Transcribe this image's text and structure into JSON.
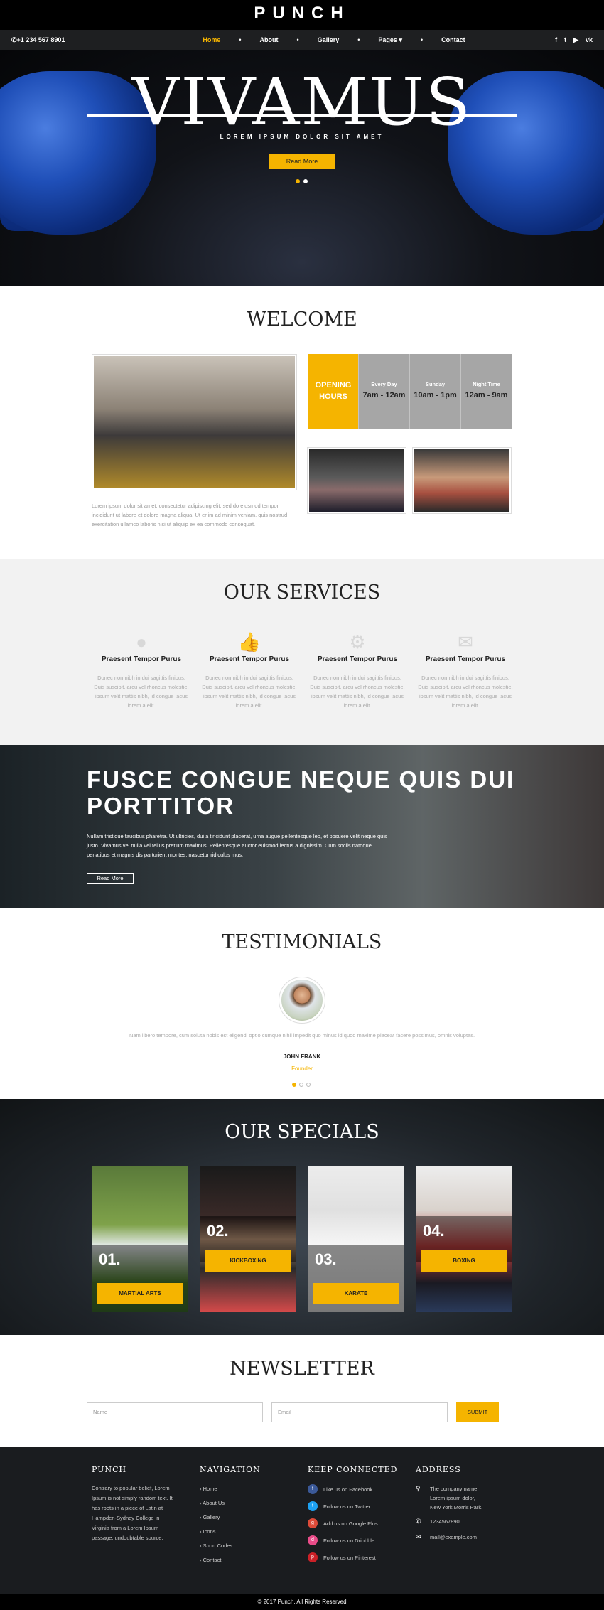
{
  "brand": "PUNCH",
  "nav": {
    "phone": "+1 234 567 8901",
    "items": [
      "Home",
      "About",
      "Gallery",
      "Pages",
      "Contact"
    ],
    "separator": "•",
    "social": [
      "f",
      "🐦",
      "▶",
      "vk"
    ],
    "active_color": "#f5b400"
  },
  "hero": {
    "title": "VIVAMUS",
    "subtitle": "LOREM IPSUM DOLOR SIT AMET",
    "button": "Read More"
  },
  "welcome": {
    "title": "WELCOME",
    "text": "Lorem ipsum dolor sit amet, consectetur adipiscing elit, sed do eiusmod tempor incididunt ut labore et dolore magna aliqua. Ut enim ad minim veniam, quis nostrud exercitation ullamco laboris nisi ut aliquip ex ea commodo consequat.",
    "opening": [
      "OPENING",
      "HOURS"
    ],
    "hours": [
      {
        "day": "Every Day",
        "time": "7am - 12am"
      },
      {
        "day": "Sunday",
        "time": "10am - 1pm"
      },
      {
        "day": "Night Time",
        "time": "12am - 9am"
      }
    ]
  },
  "services": {
    "title": "OUR SERVICES",
    "items": [
      {
        "icon": "person-icon",
        "title": "Praesent Tempor Purus",
        "text": "Donec non nibh in dui sagittis finibus. Duis suscipit, arcu vel rhoncus molestie, ipsum velit mattis nibh, id congue lacus lorem a elit."
      },
      {
        "icon": "thumbs-up-icon",
        "title": "Praesent Tempor Purus",
        "text": "Donec non nibh in dui sagittis finibus. Duis suscipit, arcu vel rhoncus molestie, ipsum velit mattis nibh, id congue lacus lorem a elit."
      },
      {
        "icon": "gear-icon",
        "title": "Praesent Tempor Purus",
        "text": "Donec non nibh in dui sagittis finibus. Duis suscipit, arcu vel rhoncus molestie, ipsum velit mattis nibh, id congue lacus lorem a elit."
      },
      {
        "icon": "envelope-icon",
        "title": "Praesent Tempor Purus",
        "text": "Donec non nibh in dui sagittis finibus. Duis suscipit, arcu vel rhoncus molestie, ipsum velit mattis nibh, id congue lacus lorem a elit."
      }
    ]
  },
  "feature": {
    "title": "FUSCE CONGUE NEQUE QUIS DUI PORTTITOR",
    "text": "Nullam tristique faucibus pharetra. Ut ultricies, dui a tincidunt placerat, urna augue pellentesque leo, et posuere velit neque quis justo. Vivamus vel nulla vel tellus pretium maximus. Pellentesque auctor euismod lectus a dignissim. Cum sociis natoque penatibus et magnis dis parturient montes, nascetur ridiculus mus.",
    "button": "Read More"
  },
  "testimonials": {
    "title": "TESTIMONIALS",
    "quote": "Nam libero tempore, cum soluta nobis est eligendi optio cumque nihil impedit quo minus id quod maxime placeat facere possimus, omnis voluptas.",
    "name": "JOHN FRANK",
    "role": "Founder"
  },
  "specials": {
    "title": "OUR SPECIALS",
    "items": [
      {
        "num": "01.",
        "label": "MARTIAL ARTS"
      },
      {
        "num": "02.",
        "label": "KICKBOXING"
      },
      {
        "num": "03.",
        "label": "KARATE"
      },
      {
        "num": "04.",
        "label": "BOXING"
      }
    ]
  },
  "newsletter": {
    "title": "NEWSLETTER",
    "name_placeholder": "Name",
    "email_placeholder": "Email",
    "button": "SUBMIT"
  },
  "footer": {
    "about_title": "PUNCH",
    "about_text": "Contrary to popular belief, Lorem Ipsum is not simply random text. It has roots in a piece of Latin at Hampden-Sydney College in Virginia from a Lorem Ipsum passage, undoubtable source.",
    "nav_title": "NAVIGATION",
    "nav_items": [
      "Home",
      "About Us",
      "Gallery",
      "Icons",
      "Short Codes",
      "Contact"
    ],
    "connect_title": "KEEP CONNECTED",
    "connect_items": [
      {
        "text": "Like us on Facebook",
        "color": "#3b5998",
        "glyph": "f"
      },
      {
        "text": "Follow us on Twitter",
        "color": "#1da1f2",
        "glyph": "t"
      },
      {
        "text": "Add us on Google Plus",
        "color": "#dd4b39",
        "glyph": "g"
      },
      {
        "text": "Follow us on Dribbble",
        "color": "#ea4c89",
        "glyph": "d"
      },
      {
        "text": "Follow us on Pinterest",
        "color": "#cb2027",
        "glyph": "p"
      }
    ],
    "address_title": "ADDRESS",
    "address": [
      "The company name",
      "Lorem ipsum dolor,",
      "New York,Morris Park."
    ],
    "phone": "1234567890",
    "email": "mail@example.com",
    "copyright": "© 2017 Punch. All Rights Reserved"
  }
}
